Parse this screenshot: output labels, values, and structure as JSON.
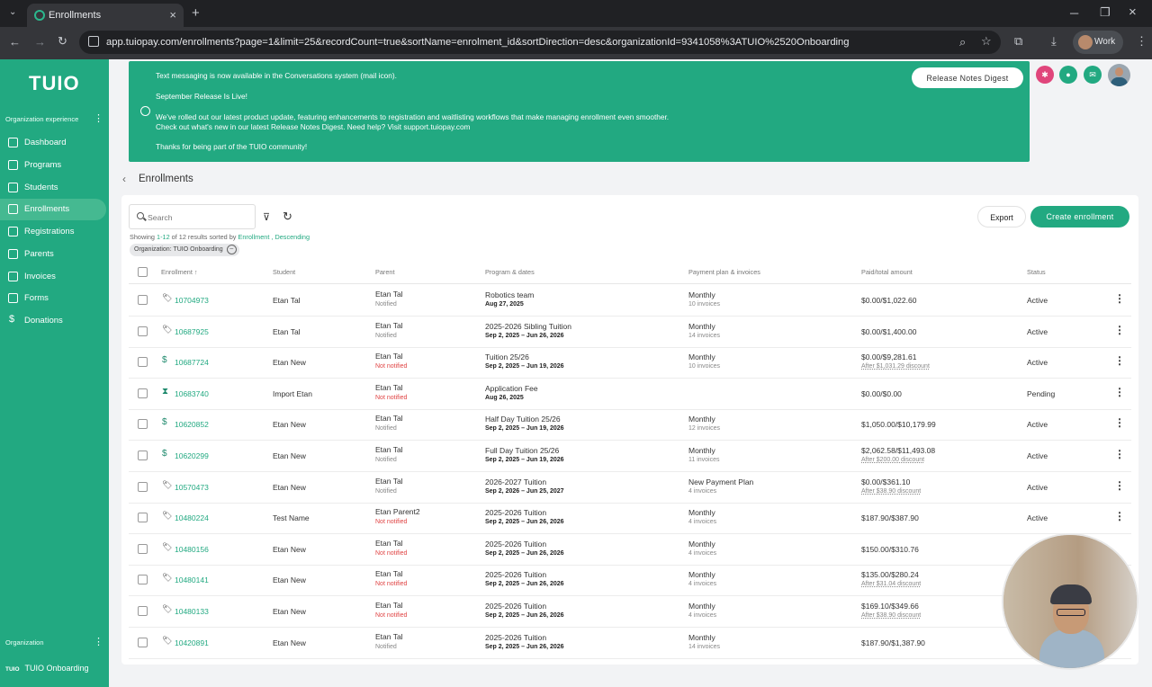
{
  "browser": {
    "tab_title": "Enrollments",
    "url": "app.tuiopay.com/enrollments?page=1&limit=25&recordCount=true&sortName=enrolment_id&sortDirection=desc&organizationId=9341058%3ATUIO%2520Onboarding",
    "profile": "Work"
  },
  "sidebar": {
    "logo": "TUIO",
    "section_label": "Organization experience",
    "items": [
      {
        "label": "Dashboard",
        "icon": "dashboard-icon"
      },
      {
        "label": "Programs",
        "icon": "programs-icon"
      },
      {
        "label": "Students",
        "icon": "graduation-cap-icon"
      },
      {
        "label": "Enrollments",
        "icon": "list-icon"
      },
      {
        "label": "Registrations",
        "icon": "registration-icon"
      },
      {
        "label": "Parents",
        "icon": "contact-icon"
      },
      {
        "label": "Invoices",
        "icon": "invoice-icon"
      },
      {
        "label": "Forms",
        "icon": "folder-icon"
      },
      {
        "label": "Donations",
        "icon": "dollar-icon"
      }
    ],
    "org_section_label": "Organization",
    "org_tag": "TUIO",
    "org_name": "TUIO Onboarding"
  },
  "banner": {
    "lines": [
      "Text messaging is now available in the Conversations system (mail icon).",
      "September Release Is Live!",
      "We've rolled out our latest product update, featuring enhancements to registration and waitlisting workflows that make managing enrollment even smoother.",
      "Check out what's new in our latest Release Notes Digest. Need help? Visit support.tuiopay.com",
      "Thanks for being part of the TUIO community!"
    ],
    "button": "Release Notes Digest"
  },
  "page": {
    "title": "Enrollments",
    "search_placeholder": "Search",
    "export": "Export",
    "create": "Create enrollment",
    "summary_prefix": "Showing ",
    "summary_range": "1-12",
    "summary_mid": " of 12 results sorted by ",
    "summary_sort": "Enrollment",
    "summary_sep": " , ",
    "summary_dir": "Descending",
    "org_chip": "Organization: TUIO Onboarding"
  },
  "columns": {
    "enrollment": "Enrollment",
    "sort_arrow": "↑",
    "student": "Student",
    "parent": "Parent",
    "program": "Program & dates",
    "payment": "Payment plan & invoices",
    "amount": "Paid/total amount",
    "status": "Status"
  },
  "rows": [
    {
      "type": "tag",
      "id": "10704973",
      "student": "Etan Tal",
      "parent": "Etan Tal",
      "notify": "Notified",
      "program": "Robotics team",
      "dates": "Aug 27, 2025",
      "plan": "Monthly",
      "invoices": "10 invoices",
      "amount": "$0.00/$1,022.60",
      "discount": "",
      "status": "Active"
    },
    {
      "type": "tag",
      "id": "10687925",
      "student": "Etan Tal",
      "parent": "Etan Tal",
      "notify": "Notified",
      "program": "2025-2026 Sibling Tuition",
      "dates": "Sep 2, 2025 – Jun 26, 2026",
      "plan": "Monthly",
      "invoices": "14 invoices",
      "amount": "$0.00/$1,400.00",
      "discount": "",
      "status": "Active"
    },
    {
      "type": "dollar",
      "id": "10687724",
      "student": "Etan New",
      "parent": "Etan Tal",
      "notify": "Not notified",
      "program": "Tuition 25/26",
      "dates": "Sep 2, 2025 – Jun 19, 2026",
      "plan": "Monthly",
      "invoices": "10 invoices",
      "amount": "$0.00/$9,281.61",
      "discount": "After $1,031.29 discount",
      "status": "Active"
    },
    {
      "type": "hourglass",
      "id": "10683740",
      "student": "Import Etan",
      "parent": "Etan Tal",
      "notify": "Not notified",
      "program": "Application Fee",
      "dates": "Aug 26, 2025",
      "plan": "",
      "invoices": "",
      "amount": "$0.00/$0.00",
      "discount": "",
      "status": "Pending"
    },
    {
      "type": "dollar",
      "id": "10620852",
      "student": "Etan New",
      "parent": "Etan Tal",
      "notify": "Notified",
      "program": "Half Day Tuition 25/26",
      "dates": "Sep 2, 2025 – Jun 19, 2026",
      "plan": "Monthly",
      "invoices": "12 invoices",
      "amount": "$1,050.00/$10,179.99",
      "discount": "",
      "status": "Active"
    },
    {
      "type": "dollar",
      "id": "10620299",
      "student": "Etan New",
      "parent": "Etan Tal",
      "notify": "Notified",
      "program": "Full Day Tuition 25/26",
      "dates": "Sep 2, 2025 – Jun 19, 2026",
      "plan": "Monthly",
      "invoices": "11 invoices",
      "amount": "$2,062.58/$11,493.08",
      "discount": "After $200.00 discount",
      "status": "Active"
    },
    {
      "type": "tag",
      "id": "10570473",
      "student": "Etan New",
      "parent": "Etan Tal",
      "notify": "Notified",
      "program": "2026-2027 Tuition",
      "dates": "Sep 2, 2026 – Jun 25, 2027",
      "plan": "New Payment Plan",
      "invoices": "4 invoices",
      "amount": "$0.00/$361.10",
      "discount": "After $38.90 discount",
      "status": "Active"
    },
    {
      "type": "tag",
      "id": "10480224",
      "student": "Test Name",
      "parent": "Etan Parent2",
      "notify": "Not notified",
      "program": "2025-2026 Tuition",
      "dates": "Sep 2, 2025 – Jun 26, 2026",
      "plan": "Monthly",
      "invoices": "4 invoices",
      "amount": "$187.90/$387.90",
      "discount": "",
      "status": "Active"
    },
    {
      "type": "tag",
      "id": "10480156",
      "student": "Etan New",
      "parent": "Etan Tal",
      "notify": "Not notified",
      "program": "2025-2026 Tuition",
      "dates": "Sep 2, 2025 – Jun 26, 2026",
      "plan": "Monthly",
      "invoices": "4 invoices",
      "amount": "$150.00/$310.76",
      "discount": "",
      "status": ""
    },
    {
      "type": "tag",
      "id": "10480141",
      "student": "Etan New",
      "parent": "Etan Tal",
      "notify": "Not notified",
      "program": "2025-2026 Tuition",
      "dates": "Sep 2, 2025 – Jun 26, 2026",
      "plan": "Monthly",
      "invoices": "4 invoices",
      "amount": "$135.00/$280.24",
      "discount": "After $31.04 discount",
      "status": ""
    },
    {
      "type": "tag",
      "id": "10480133",
      "student": "Etan New",
      "parent": "Etan Tal",
      "notify": "Not notified",
      "program": "2025-2026 Tuition",
      "dates": "Sep 2, 2025 – Jun 26, 2026",
      "plan": "Monthly",
      "invoices": "4 invoices",
      "amount": "$169.10/$349.66",
      "discount": "After $38.90 discount",
      "status": ""
    },
    {
      "type": "tag",
      "id": "10420891",
      "student": "Etan New",
      "parent": "Etan Tal",
      "notify": "Notified",
      "program": "2025-2026 Tuition",
      "dates": "Sep 2, 2025 – Jun 26, 2026",
      "plan": "Monthly",
      "invoices": "14 invoices",
      "amount": "$187.90/$1,387.90",
      "discount": "",
      "status": ""
    }
  ],
  "colors": {
    "brand": "#22a981",
    "warn": "#e04545"
  }
}
